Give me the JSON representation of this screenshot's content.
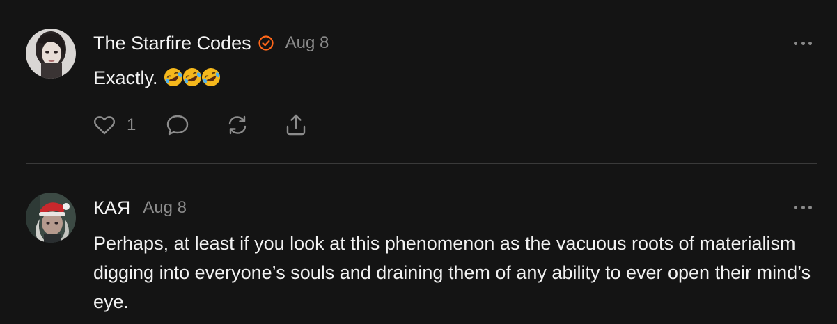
{
  "comments": [
    {
      "author": "The Starfire Codes",
      "verified": true,
      "date": "Aug 8",
      "body": "Exactly.",
      "emoji_count": 3,
      "likes": "1"
    },
    {
      "author": "КАЯ",
      "verified": false,
      "date": "Aug 8",
      "body": "Perhaps, at least if you look at this phenomenon as the vacuous roots of materialism digging into everyone’s souls and draining them of any ability to ever open their mind’s eye."
    }
  ],
  "icons": {
    "verified": "verified-check-icon",
    "like": "heart-icon",
    "reply": "speech-bubble-icon",
    "restack": "restack-arrows-icon",
    "share": "share-upload-icon",
    "more": "ellipsis-icon"
  },
  "colors": {
    "background": "#141414",
    "accent": "#ff6719",
    "muted": "#8c8c8c"
  }
}
